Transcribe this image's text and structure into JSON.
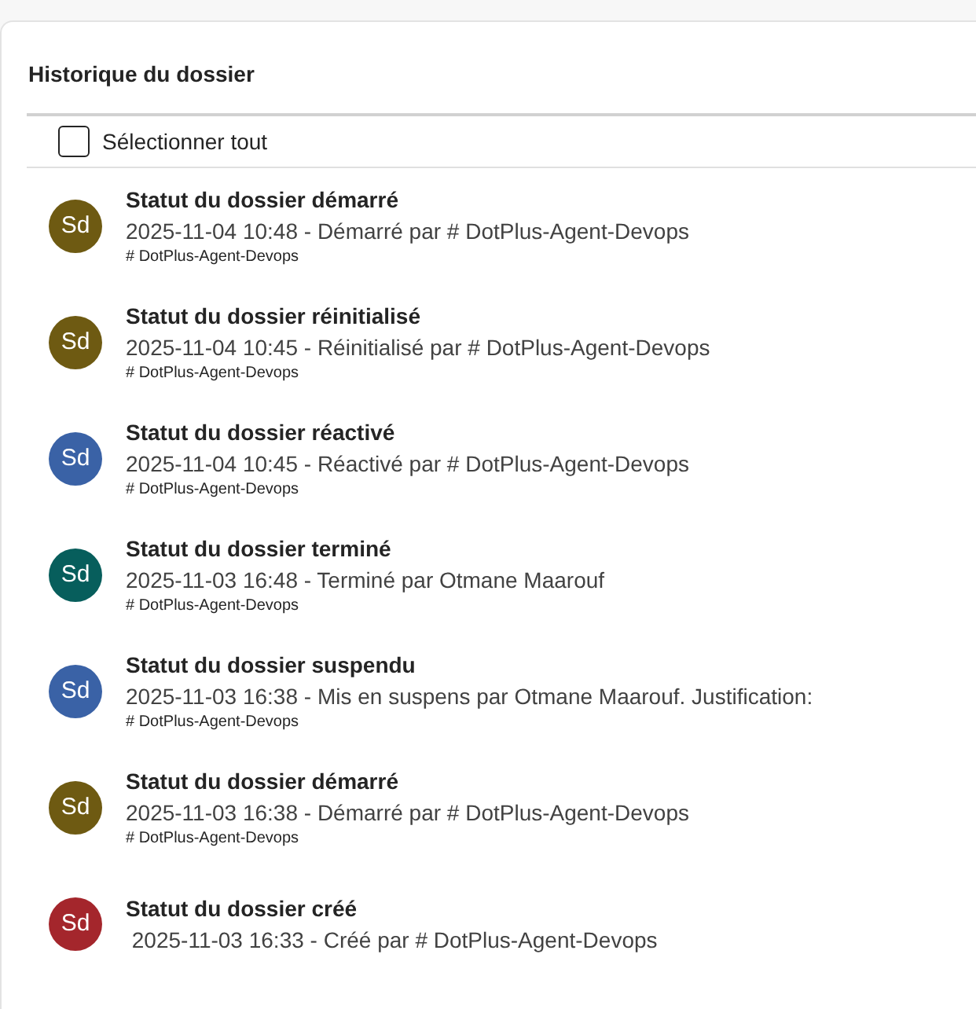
{
  "panel": {
    "title": "Historique du dossier"
  },
  "select_all": {
    "label": "Sélectionner tout",
    "checked": false
  },
  "entries": [
    {
      "initials": "Sd",
      "color": "#6e5a12",
      "title": "Statut du dossier démarré",
      "description": "2025-11-04 10:48 - Démarré par # DotPlus-Agent-Devops",
      "meta": "# DotPlus-Agent-Devops"
    },
    {
      "initials": "Sd",
      "color": "#6e5a12",
      "title": "Statut du dossier réinitialisé",
      "description": "2025-11-04 10:45 - Réinitialisé par # DotPlus-Agent-Devops",
      "meta": "# DotPlus-Agent-Devops"
    },
    {
      "initials": "Sd",
      "color": "#3a62a6",
      "title": "Statut du dossier réactivé",
      "description": "2025-11-04 10:45 - Réactivé par # DotPlus-Agent-Devops",
      "meta": "# DotPlus-Agent-Devops"
    },
    {
      "initials": "Sd",
      "color": "#075e5c",
      "title": "Statut du dossier terminé",
      "description": "2025-11-03 16:48 - Terminé par Otmane Maarouf",
      "meta": "# DotPlus-Agent-Devops"
    },
    {
      "initials": "Sd",
      "color": "#3a62a6",
      "title": "Statut du dossier suspendu",
      "description": "2025-11-03 16:38 - Mis en suspens par Otmane Maarouf. Justification:",
      "meta": "# DotPlus-Agent-Devops"
    },
    {
      "initials": "Sd",
      "color": "#6e5a12",
      "title": "Statut du dossier démarré",
      "description": "2025-11-03 16:38 - Démarré par # DotPlus-Agent-Devops",
      "meta": "# DotPlus-Agent-Devops"
    },
    {
      "initials": "Sd",
      "color": "#a4262c",
      "title": "Statut du dossier créé",
      "description": " 2025-11-03 16:33 - Créé par # DotPlus-Agent-Devops"
    }
  ]
}
